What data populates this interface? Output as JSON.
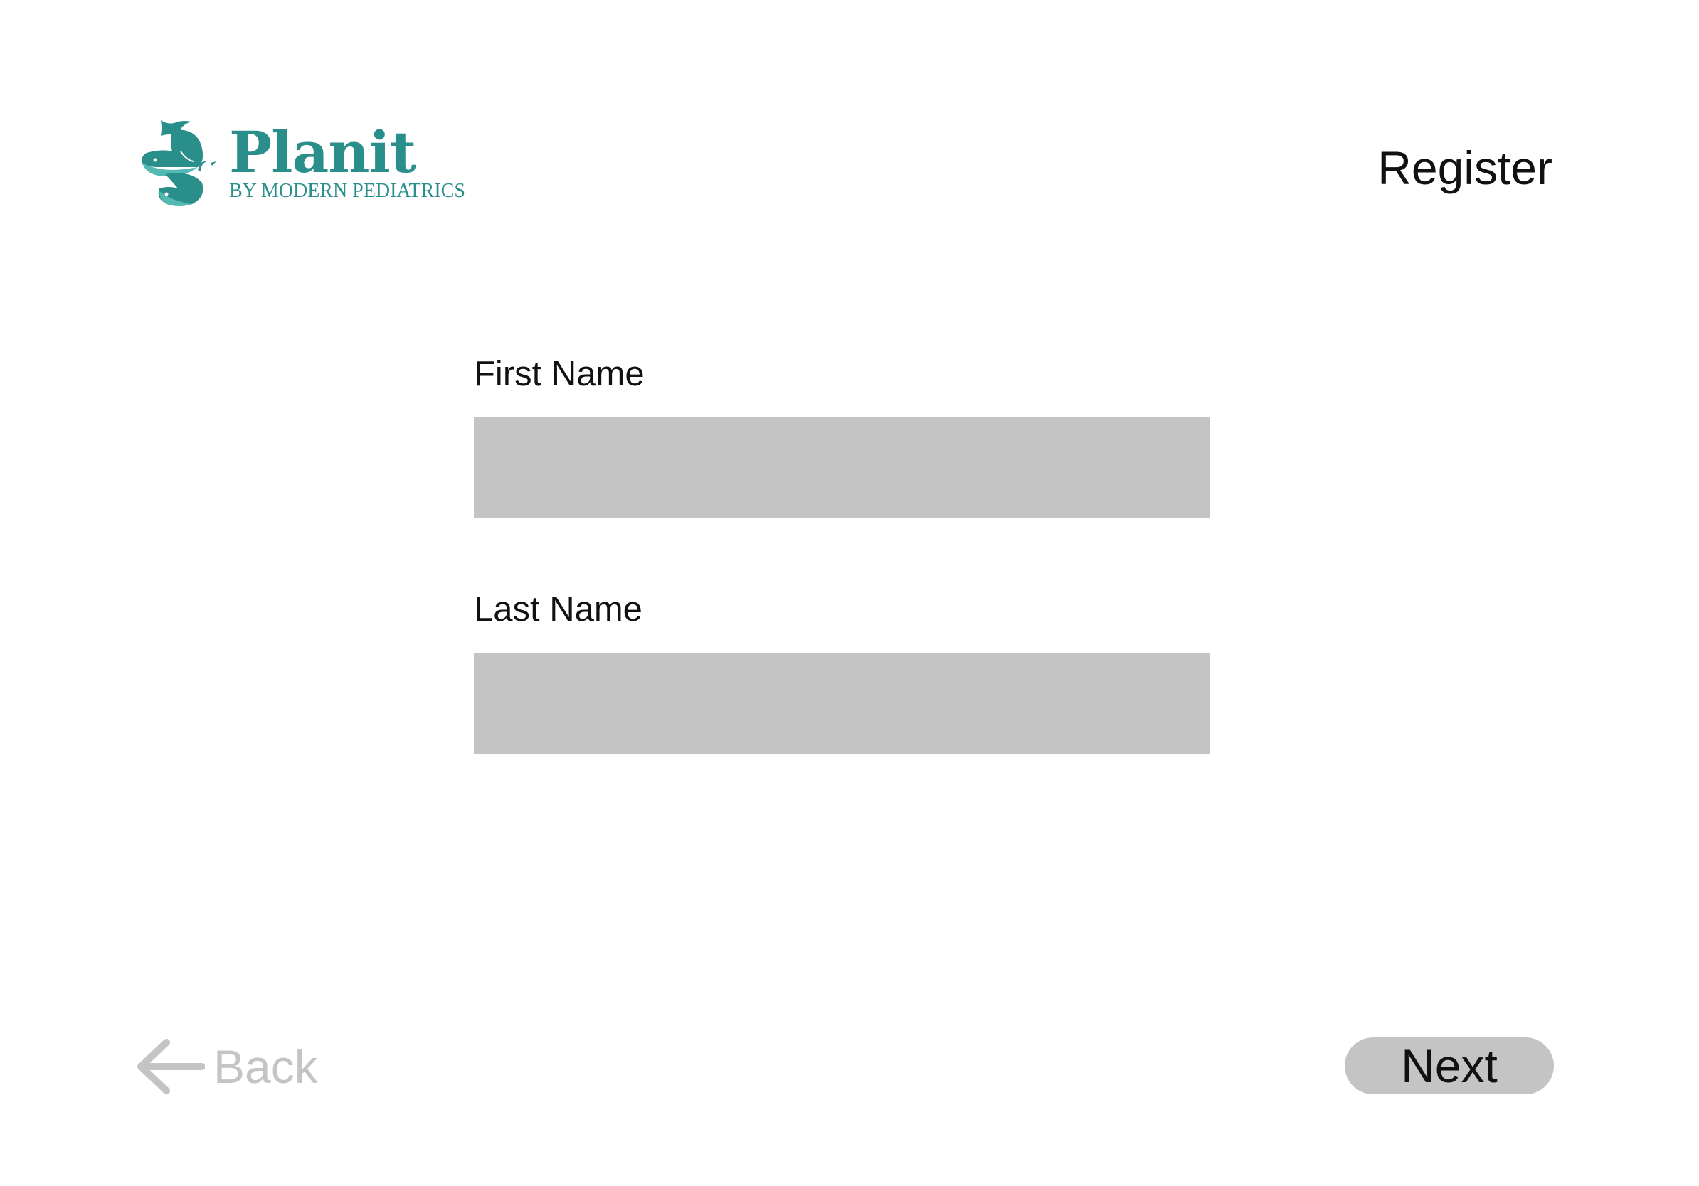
{
  "brand": {
    "name": "Planit",
    "tagline": "BY MODERN PEDIATRICS",
    "color": "#2a8f8a",
    "icon": "whale-stack-logo-icon"
  },
  "header": {
    "title": "Register"
  },
  "form": {
    "first_name": {
      "label": "First Name",
      "value": "",
      "placeholder": ""
    },
    "last_name": {
      "label": "Last Name",
      "value": "",
      "placeholder": ""
    }
  },
  "footer": {
    "back_label": "Back",
    "back_icon": "arrow-left-icon",
    "next_label": "Next"
  },
  "colors": {
    "input_fill": "#c4c4c4",
    "disabled_text": "#c4c4c4",
    "text": "#111111",
    "background": "#ffffff"
  }
}
